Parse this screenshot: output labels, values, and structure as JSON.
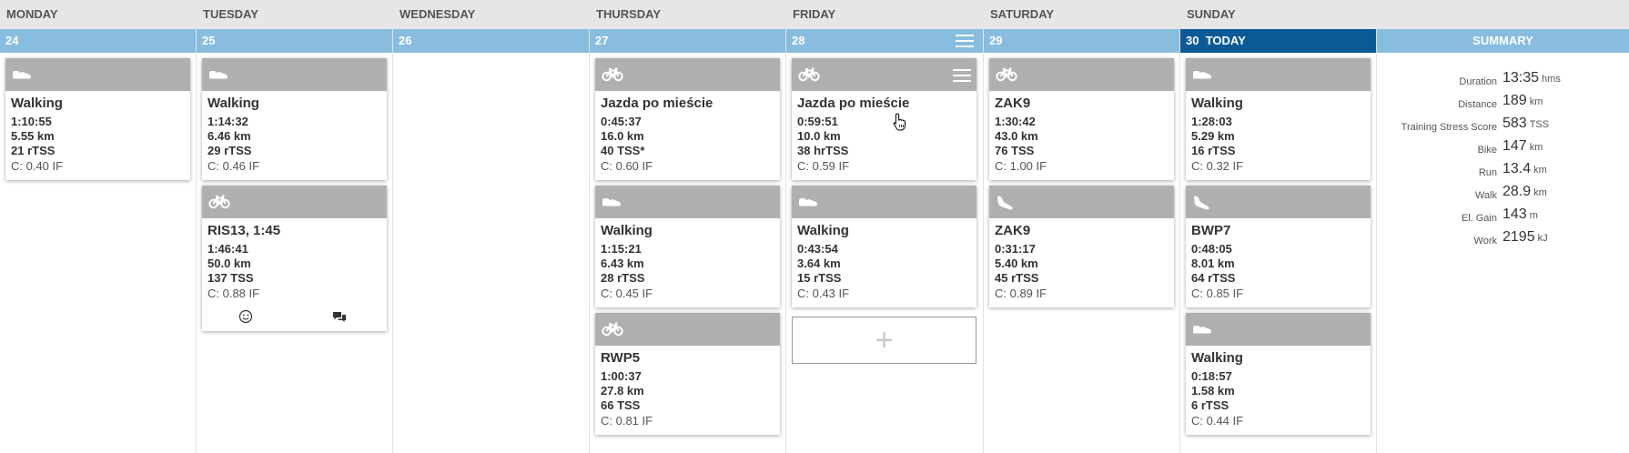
{
  "days": [
    {
      "name": "MONDAY",
      "date": "24",
      "today_label": "",
      "has_menu": false,
      "cards": [
        {
          "sport": "walk",
          "title": "Walking",
          "lines": [
            "1:10:55",
            "5.55 km",
            "21 rTSS"
          ],
          "if": "C: 0.40 IF",
          "footer": false
        }
      ]
    },
    {
      "name": "TUESDAY",
      "date": "25",
      "today_label": "",
      "has_menu": false,
      "cards": [
        {
          "sport": "walk",
          "title": "Walking",
          "lines": [
            "1:14:32",
            "6.46 km",
            "29 rTSS"
          ],
          "if": "C: 0.46 IF",
          "footer": false
        },
        {
          "sport": "bike",
          "title": "RIS13, 1:45",
          "lines": [
            "1:46:41",
            "50.0 km",
            "137 TSS"
          ],
          "if": "C: 0.88 IF",
          "footer": true
        }
      ]
    },
    {
      "name": "WEDNESDAY",
      "date": "26",
      "today_label": "",
      "has_menu": false,
      "cards": []
    },
    {
      "name": "THURSDAY",
      "date": "27",
      "today_label": "",
      "has_menu": false,
      "cards": [
        {
          "sport": "bike",
          "title": "Jazda po mieście",
          "lines": [
            "0:45:37",
            "16.0 km",
            "40 TSS*"
          ],
          "if": "C: 0.60 IF",
          "footer": false
        },
        {
          "sport": "walk",
          "title": "Walking",
          "lines": [
            "1:15:21",
            "6.43 km",
            "28 rTSS"
          ],
          "if": "C: 0.45 IF",
          "footer": false
        },
        {
          "sport": "bike",
          "title": "RWP5",
          "lines": [
            "1:00:37",
            "27.8 km",
            "66 TSS"
          ],
          "if": "C: 0.81 IF",
          "footer": false
        }
      ]
    },
    {
      "name": "FRIDAY",
      "date": "28",
      "today_label": "",
      "has_menu": true,
      "cards": [
        {
          "sport": "bike",
          "title": "Jazda po mieście",
          "lines": [
            "0:59:51",
            "10.0 km",
            "38 hrTSS"
          ],
          "if": "C: 0.59 IF",
          "footer": false,
          "menu": true
        },
        {
          "sport": "walk",
          "title": "Walking",
          "lines": [
            "0:43:54",
            "3.64 km",
            "15 rTSS"
          ],
          "if": "C: 0.43 IF",
          "footer": false
        }
      ],
      "add": true
    },
    {
      "name": "SATURDAY",
      "date": "29",
      "today_label": "",
      "has_menu": false,
      "cards": [
        {
          "sport": "bike",
          "title": "ZAK9",
          "lines": [
            "1:30:42",
            "43.0 km",
            "76 TSS"
          ],
          "if": "C: 1.00 IF",
          "footer": false
        },
        {
          "sport": "run",
          "title": "ZAK9",
          "lines": [
            "0:31:17",
            "5.40 km",
            "45 rTSS"
          ],
          "if": "C: 0.89 IF",
          "footer": false
        }
      ]
    },
    {
      "name": "SUNDAY",
      "date": "30",
      "today_label": "TODAY",
      "has_menu": false,
      "today": true,
      "cards": [
        {
          "sport": "walk",
          "title": "Walking",
          "lines": [
            "1:28:03",
            "5.29 km",
            "16 rTSS"
          ],
          "if": "C: 0.32 IF",
          "footer": false
        },
        {
          "sport": "run",
          "title": "BWP7",
          "lines": [
            "0:48:05",
            "8.01 km",
            "64 rTSS"
          ],
          "if": "C: 0.85 IF",
          "footer": false
        },
        {
          "sport": "walk",
          "title": "Walking",
          "lines": [
            "0:18:57",
            "1.58 km",
            "6 rTSS"
          ],
          "if": "C: 0.44 IF",
          "footer": false
        }
      ]
    }
  ],
  "add_label": "+",
  "summary": {
    "title": "SUMMARY",
    "rows": [
      {
        "label": "Duration",
        "value": "13:35",
        "unit": "hms"
      },
      {
        "label": "Distance",
        "value": "189",
        "unit": "km"
      },
      {
        "label": "Training Stress Score",
        "value": "583",
        "unit": "TSS"
      },
      {
        "label": "Bike",
        "value": "147",
        "unit": "km"
      },
      {
        "label": "Run",
        "value": "13.4",
        "unit": "km"
      },
      {
        "label": "Walk",
        "value": "28.9",
        "unit": "km"
      },
      {
        "label": "El. Gain",
        "value": "143",
        "unit": "m"
      },
      {
        "label": "Work",
        "value": "2195",
        "unit": "kJ"
      }
    ]
  },
  "icons": {
    "walk": "shoe-icon",
    "run": "running-shoe-icon",
    "bike": "bike-icon",
    "menu": "menu-icon",
    "smile": "smiley-icon",
    "comment": "comments-icon",
    "cursor": "hand-cursor-icon"
  }
}
